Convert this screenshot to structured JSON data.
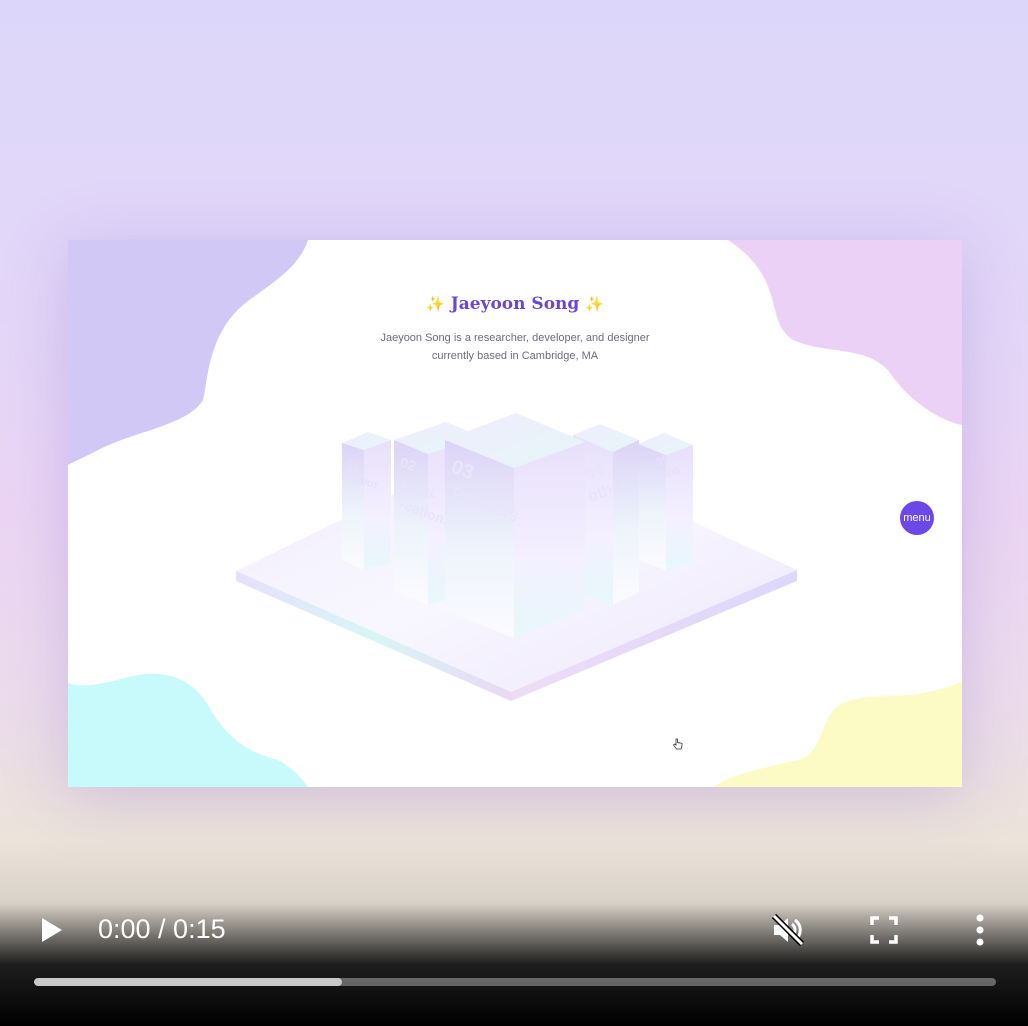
{
  "slide": {
    "title": "Jaeyoon Song",
    "sparkle": "✨",
    "subtitle_line1": "Jaeyoon Song is a researcher, developer, and designer",
    "subtitle_line2": "currently based in Cambridge, MA",
    "menu_label": "menu",
    "nav_blocks": [
      {
        "number": "01",
        "label": "About"
      },
      {
        "number": "02",
        "label": "Publi-",
        "label2": "-cations"
      },
      {
        "number": "03",
        "label": "Projects"
      },
      {
        "number": "04",
        "label": "other"
      },
      {
        "number": "05",
        "label": "Blog"
      }
    ],
    "colors": {
      "accent": "#6c48e8",
      "blob_lavender": "#d2c8f6",
      "blob_pink": "#ebd1f5",
      "blob_cyan": "#c8fafc",
      "blob_yellow": "#fcfbc6"
    }
  },
  "player": {
    "time": "0:00 / 0:15",
    "progress": 0.32,
    "icons": [
      "play-icon",
      "mute-icon",
      "fullscreen-icon",
      "more-vertical-icon"
    ]
  }
}
